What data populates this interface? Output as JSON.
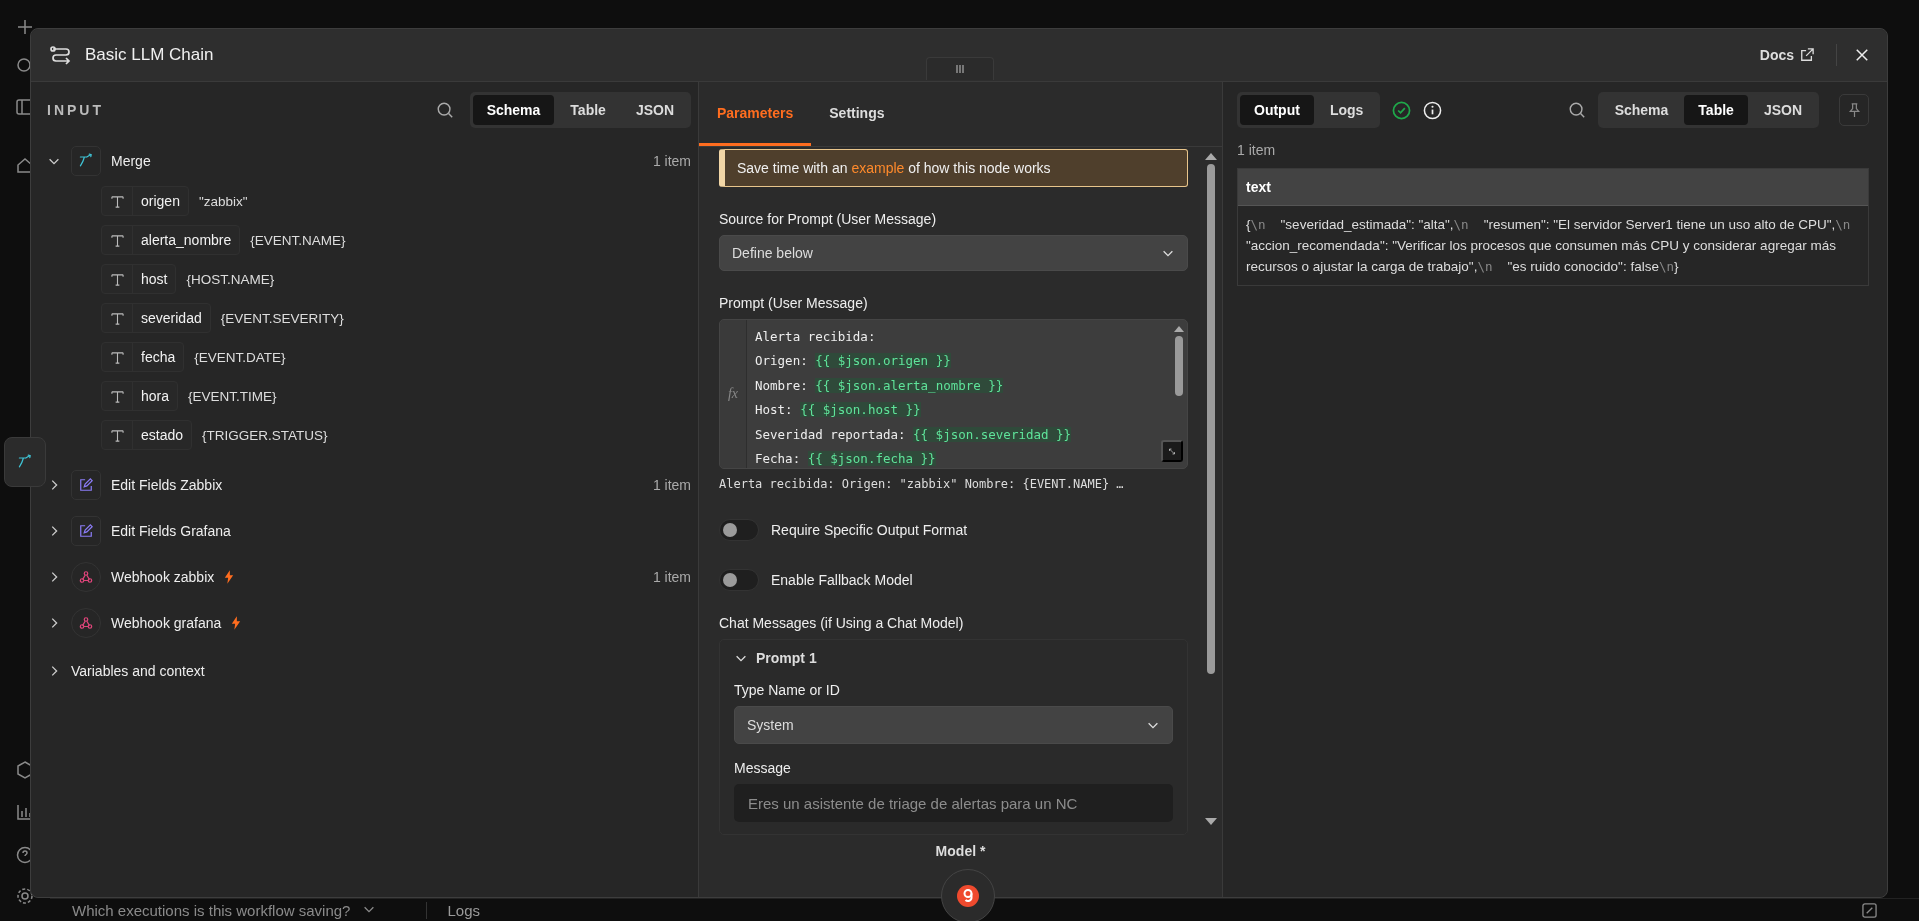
{
  "window": {
    "title": "Basic LLM Chain",
    "docs_label": "Docs"
  },
  "input_panel": {
    "title": "INPUT",
    "view_tabs": [
      {
        "label": "Schema",
        "selected": true
      },
      {
        "label": "Table",
        "selected": false
      },
      {
        "label": "JSON",
        "selected": false
      }
    ],
    "nodes": [
      {
        "name": "Merge",
        "kind": "merge",
        "expanded": true,
        "trigger": false,
        "count": "1 item",
        "fields": [
          {
            "name": "origen",
            "value": "\"zabbix\""
          },
          {
            "name": "alerta_nombre",
            "value": "{EVENT.NAME}"
          },
          {
            "name": "host",
            "value": "{HOST.NAME}"
          },
          {
            "name": "severidad",
            "value": "{EVENT.SEVERITY}"
          },
          {
            "name": "fecha",
            "value": "{EVENT.DATE}"
          },
          {
            "name": "hora",
            "value": "{EVENT.TIME}"
          },
          {
            "name": "estado",
            "value": "{TRIGGER.STATUS}"
          }
        ]
      },
      {
        "name": "Edit Fields Zabbix",
        "kind": "edit",
        "expanded": false,
        "trigger": false,
        "count": "1 item"
      },
      {
        "name": "Edit Fields Grafana",
        "kind": "edit",
        "expanded": false,
        "trigger": false
      },
      {
        "name": "Webhook zabbix",
        "kind": "webhook",
        "expanded": false,
        "trigger": true,
        "count": "1 item"
      },
      {
        "name": "Webhook grafana",
        "kind": "webhook",
        "expanded": false,
        "trigger": true
      }
    ],
    "variables": {
      "label": "Variables and context",
      "expanded": false
    }
  },
  "parameters_panel": {
    "tabs": [
      {
        "label": "Parameters",
        "selected": true
      },
      {
        "label": "Settings",
        "selected": false
      }
    ],
    "notice": {
      "before": "Save time with an ",
      "link": "example",
      "after": " of how this node works"
    },
    "source": {
      "label": "Source for Prompt (User Message)",
      "value": "Define below"
    },
    "prompt": {
      "label": "Prompt (User Message)",
      "fx": "fx",
      "lines": [
        {
          "text": "Alerta recibida:"
        },
        {
          "text": "Origen: ",
          "expr": "{{ $json.origen }}"
        },
        {
          "text": "Nombre: ",
          "expr": "{{ $json.alerta_nombre }}"
        },
        {
          "text": "Host: ",
          "expr": "{{ $json.host }}"
        },
        {
          "text": "Severidad reportada: ",
          "expr": "{{ $json.severidad }}"
        },
        {
          "text": "Fecha: ",
          "expr": "{{ $json.fecha }}"
        }
      ],
      "preview": "Alerta recibida: Origen: \"zabbix\" Nombre: {EVENT.NAME} …"
    },
    "toggles": [
      {
        "label": "Require Specific Output Format",
        "on": false
      },
      {
        "label": "Enable Fallback Model",
        "on": false
      }
    ],
    "chat_messages": {
      "label": "Chat Messages (if Using a Chat Model)",
      "prompts": [
        {
          "title": "Prompt 1",
          "expanded": true,
          "type_label": "Type Name or ID",
          "type_value": "System",
          "message_label": "Message",
          "message_value": "Eres un asistente de triage de alertas para un NC"
        }
      ]
    },
    "model_label": "Model *"
  },
  "output_panel": {
    "mode_tabs": [
      {
        "label": "Output",
        "selected": true
      },
      {
        "label": "Logs",
        "selected": false
      }
    ],
    "succeeded": true,
    "view_tabs": [
      {
        "label": "Schema",
        "selected": false
      },
      {
        "label": "Table",
        "selected": true
      },
      {
        "label": "JSON",
        "selected": false
      }
    ],
    "count": "1 item",
    "table": {
      "columns": [
        "text"
      ],
      "rows": [
        [
          [
            {
              "kind": "text",
              "text": "{"
            },
            {
              "kind": "escape",
              "text": "\\n"
            },
            {
              "kind": "text",
              "text": "    \"severidad_estimada\": \"alta\","
            },
            {
              "kind": "escape",
              "text": "\\n"
            },
            {
              "kind": "text",
              "text": "    \"resumen\": \"El servidor Server1 tiene un uso alto de CPU\","
            },
            {
              "kind": "escape",
              "text": "\\n"
            },
            {
              "kind": "text",
              "text": "    \"accion_recomendada\": \"Verificar los procesos que consumen más CPU y considerar agregar más recursos o ajustar la carga de trabajo\","
            },
            {
              "kind": "escape",
              "text": "\\n"
            },
            {
              "kind": "text",
              "text": "    \"es ruido conocido\": false"
            },
            {
              "kind": "escape",
              "text": "\\n"
            },
            {
              "kind": "text",
              "text": "}"
            }
          ]
        ]
      ]
    }
  },
  "bottom_bar": {
    "executions_label": "Which executions is this workflow saving?",
    "logs_label": "Logs"
  }
}
